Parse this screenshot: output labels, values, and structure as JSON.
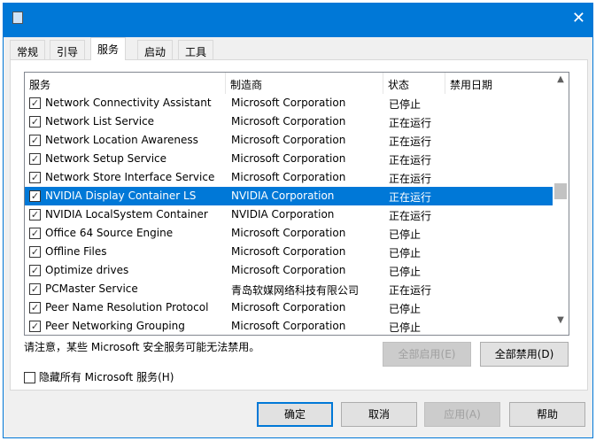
{
  "window": {
    "close": "✕"
  },
  "tabs": [
    "常规",
    "引导",
    "服务",
    "启动",
    "工具"
  ],
  "columns": [
    "服务",
    "制造商",
    "状态",
    "禁用日期"
  ],
  "rows": [
    {
      "name": "Network Connectivity Assistant",
      "maker": "Microsoft Corporation",
      "status": "已停止"
    },
    {
      "name": "Network List Service",
      "maker": "Microsoft Corporation",
      "status": "正在运行"
    },
    {
      "name": "Network Location Awareness",
      "maker": "Microsoft Corporation",
      "status": "正在运行"
    },
    {
      "name": "Network Setup Service",
      "maker": "Microsoft Corporation",
      "status": "正在运行"
    },
    {
      "name": "Network Store Interface Service",
      "maker": "Microsoft Corporation",
      "status": "正在运行"
    },
    {
      "name": "NVIDIA Display Container LS",
      "maker": "NVIDIA Corporation",
      "status": "正在运行"
    },
    {
      "name": "NVIDIA LocalSystem Container",
      "maker": "NVIDIA Corporation",
      "status": "正在运行"
    },
    {
      "name": "Office 64 Source Engine",
      "maker": "Microsoft Corporation",
      "status": "已停止"
    },
    {
      "name": "Offline Files",
      "maker": "Microsoft Corporation",
      "status": "已停止"
    },
    {
      "name": "Optimize drives",
      "maker": "Microsoft Corporation",
      "status": "已停止"
    },
    {
      "name": "PCMaster Service",
      "maker": "青岛软媒网络科技有限公司",
      "status": "正在运行"
    },
    {
      "name": "Peer Name Resolution Protocol",
      "maker": "Microsoft Corporation",
      "status": "已停止"
    },
    {
      "name": "Peer Networking Grouping",
      "maker": "Microsoft Corporation",
      "status": "已停止"
    }
  ],
  "selected_index": 5,
  "note": "请注意，某些 Microsoft 安全服务可能无法禁用。",
  "enable_all": "全部启用(E)",
  "disable_all": "全部禁用(D)",
  "hide_ms": "隐藏所有 Microsoft 服务(H)",
  "buttons": {
    "ok": "确定",
    "cancel": "取消",
    "apply": "应用(A)",
    "help": "帮助"
  }
}
